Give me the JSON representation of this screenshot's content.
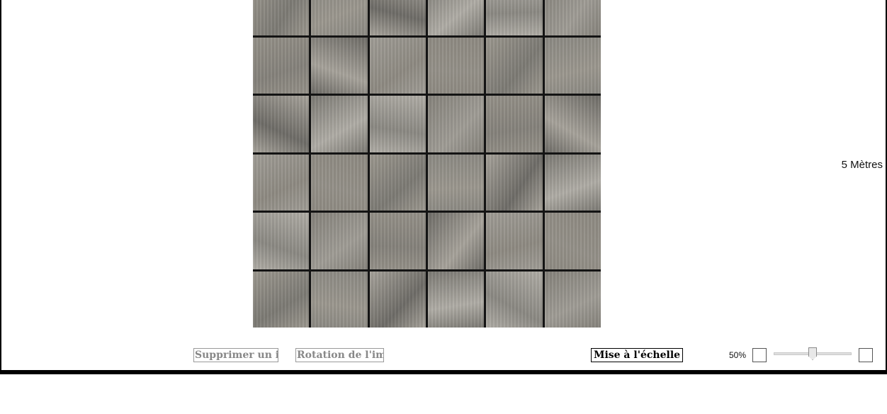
{
  "canvas": {
    "scale_label": "5 Mètres"
  },
  "toolbar": {
    "delete_label": "Supprimer un item",
    "rotate_label": "Rotation de l'image",
    "scale_button_label": "Mise à l'échelle",
    "zoom_value": "50%",
    "zoom_slider_level": 0.5
  },
  "image": {
    "icon": "mosaic-tile-image",
    "rows": 6,
    "columns": 6
  }
}
